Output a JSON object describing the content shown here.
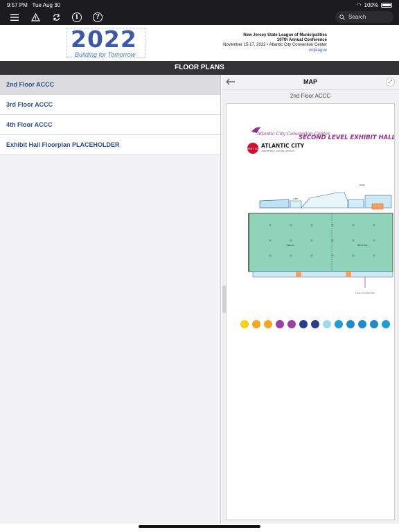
{
  "status": {
    "time": "9:57 PM",
    "date": "Tue Aug 30",
    "battery": "100%"
  },
  "toolbar": {
    "icons": [
      "menu-icon",
      "alert-icon",
      "refresh-icon",
      "info-icon",
      "help-icon"
    ],
    "search_placeholder": "Search"
  },
  "banner": {
    "logo_year": "2022",
    "logo_tagline": "Building for Tomorrow",
    "org": "New Jersey State League of Municipalities",
    "conference": "107th Annual Conference",
    "dates_venue": "November 15-17, 2022 • Atlantic City Convention Center",
    "hashtag": "#njleague"
  },
  "page_title": "FLOOR PLANS",
  "floor_plans": [
    {
      "label": "2nd Floor ACCC",
      "selected": true
    },
    {
      "label": "3rd Floor ACCC",
      "selected": false
    },
    {
      "label": "4th Floor ACCC",
      "selected": false
    },
    {
      "label": "Exhibit Hall Floorplan PLACEHOLDER",
      "selected": false
    }
  ],
  "map": {
    "header": "MAP",
    "subtitle": "2nd Floor ACCC",
    "venue_logo": "Atlantic City Convention Center",
    "meet_ac": "MEET AC",
    "venue_brand": "ATLANTIC CITY",
    "venue_brand_sub": "CONVENTION & VISITORS AUTHORITY",
    "plan_title": "SECOND LEVEL EXHIBIT HALL",
    "hall_label": "HALL D",
    "flex_label": "FLEX HALL",
    "marker_label": "HALL D DOCK LED",
    "legend_colors": [
      "#f3d21c",
      "#f5a623",
      "#f5a623",
      "#9b3fa0",
      "#9b3fa0",
      "#2a3d8f",
      "#2a3d8f",
      "#9ed7ef",
      "#1f9cd8",
      "#1f8bc9",
      "#1f8bc9",
      "#1f8bc9",
      "#1f9cd8"
    ]
  }
}
